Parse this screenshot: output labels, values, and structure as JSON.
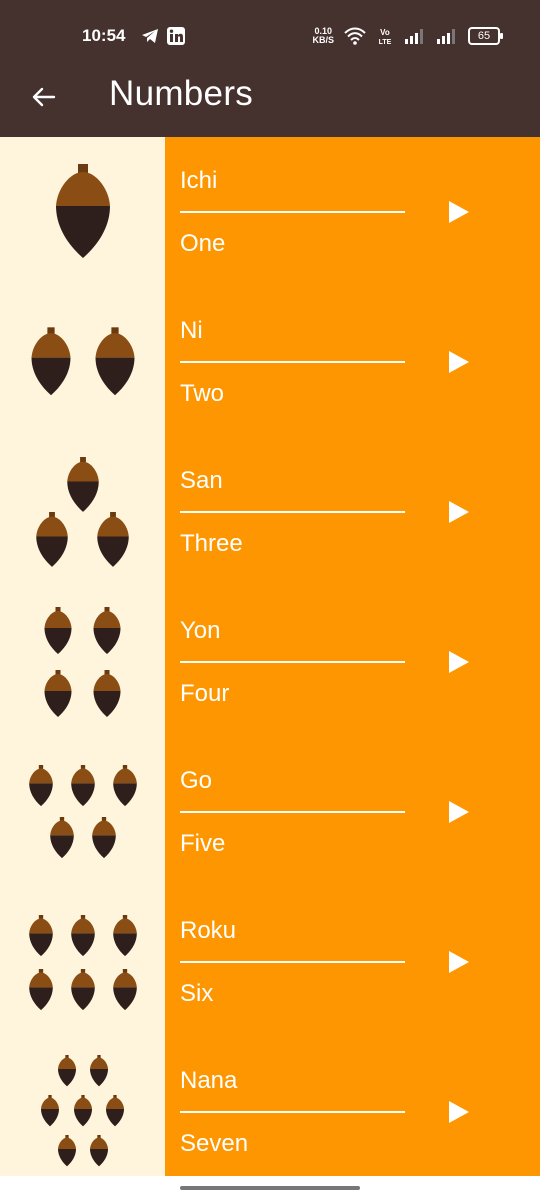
{
  "status_bar": {
    "time": "10:54",
    "net_speed_value": "0.10",
    "net_speed_unit": "KB/S",
    "battery": "65"
  },
  "app_bar": {
    "title": "Numbers"
  },
  "colors": {
    "bar_bg": "#45312d",
    "image_bg": "#fef5dc",
    "row_bg": "#fd9601",
    "acorn_cap": "#8a4e14",
    "acorn_body": "#2f1f1c"
  },
  "numbers": [
    {
      "japanese": "Ichi",
      "english": "One"
    },
    {
      "japanese": "Ni",
      "english": "Two"
    },
    {
      "japanese": "San",
      "english": "Three"
    },
    {
      "japanese": "Yon",
      "english": "Four"
    },
    {
      "japanese": "Go",
      "english": "Five"
    },
    {
      "japanese": "Roku",
      "english": "Six"
    },
    {
      "japanese": "Nana",
      "english": "Seven"
    }
  ]
}
